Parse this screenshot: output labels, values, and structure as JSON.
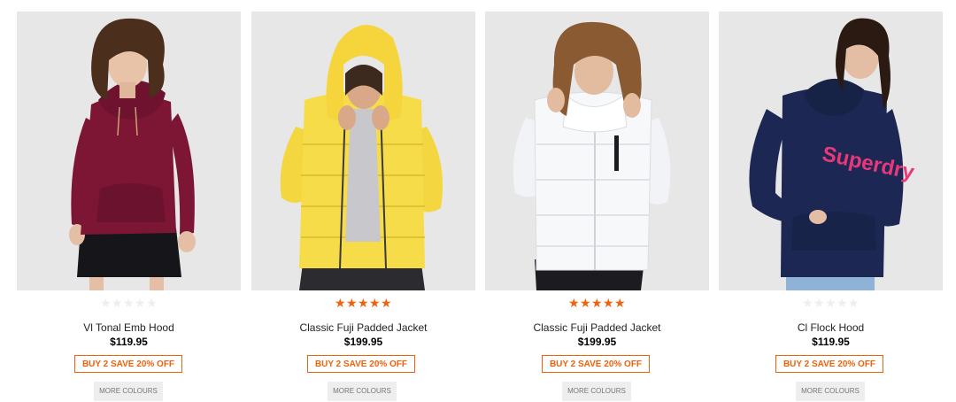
{
  "products": [
    {
      "title": "Vl Tonal Emb Hood",
      "price": "$119.95",
      "promo": "BUY 2 SAVE 20% OFF",
      "more": "MORE COLOURS",
      "rating": 0,
      "garment_color": "#7d1535"
    },
    {
      "title": "Classic Fuji Padded Jacket",
      "price": "$199.95",
      "promo": "BUY 2 SAVE 20% OFF",
      "more": "MORE COLOURS",
      "rating": 5,
      "garment_color": "#f7dc4a"
    },
    {
      "title": "Classic Fuji Padded Jacket",
      "price": "$199.95",
      "promo": "BUY 2 SAVE 20% OFF",
      "more": "MORE COLOURS",
      "rating": 5,
      "garment_color": "#f7f8fa"
    },
    {
      "title": "Cl Flock Hood",
      "price": "$119.95",
      "promo": "BUY 2 SAVE 20% OFF",
      "more": "MORE COLOURS",
      "rating": 0,
      "garment_color": "#1c2853"
    }
  ],
  "colors": {
    "accent": "#f0620a",
    "photo_bg": "#e7e7e7",
    "button_bg": "#eeeeee"
  },
  "brand_print": "Superdry"
}
